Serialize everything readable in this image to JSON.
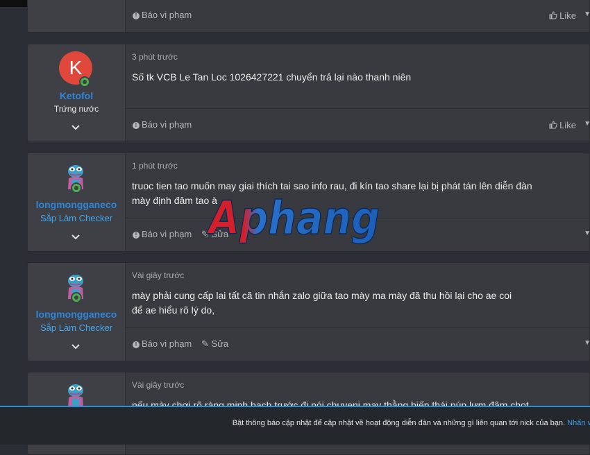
{
  "posts": [
    {
      "time": "",
      "message": [],
      "report": "Báo vi phạm",
      "edit": "",
      "like": "Like"
    },
    {
      "user": {
        "initial": "K",
        "name": "Ketofol",
        "title": "Trứng nước"
      },
      "time": "3 phút trước",
      "message": [
        "Số tk VCB Le Tan Loc 1026427221 chuyển trả lại nào thanh niên"
      ],
      "report": "Báo vi phạm",
      "like": "Like"
    },
    {
      "user": {
        "name": "longmongganeco",
        "title": "Sắp Làm Checker"
      },
      "time": "1 phút trước",
      "message": [
        "truoc tien tao muốn may giai thích tai sao info rau, đi kín tao share lại bị phát tán lên diễn đàn",
        "mày định đâm tao à"
      ],
      "report": "Báo vi phạm",
      "edit": "Sửa"
    },
    {
      "user": {
        "name": "longmongganeco",
        "title": "Sắp Làm Checker"
      },
      "time": "Vài giây trước",
      "message": [
        "mày phải cung cấp lai tất cã tin nhắn zalo giữa tao mày ma mày đã thu hồi lại cho ae coi",
        "để ae hiểu rõ lý do,"
      ],
      "report": "Báo vi phạm",
      "edit": "Sửa"
    },
    {
      "time": "Vài giây trước",
      "message": [
        "nếu mày chơi rõ ràng minh bạch trước đi nói chuyenj may thằng biến thái núp lưm đâm chọt"
      ]
    }
  ],
  "watermark": "Aphang",
  "notice": {
    "text": "Bật thông báo cập nhật để cập nhật về hoạt động diễn đàn và những gì liên quan tới nick của bạn.",
    "link": "Nhấn v"
  },
  "colors": {
    "accent": "#2b8fd6",
    "username": "#2f86d8",
    "user_title_blue": "#42a6f0",
    "avatar_bg": "#e0483c",
    "online": "#4caf50"
  }
}
